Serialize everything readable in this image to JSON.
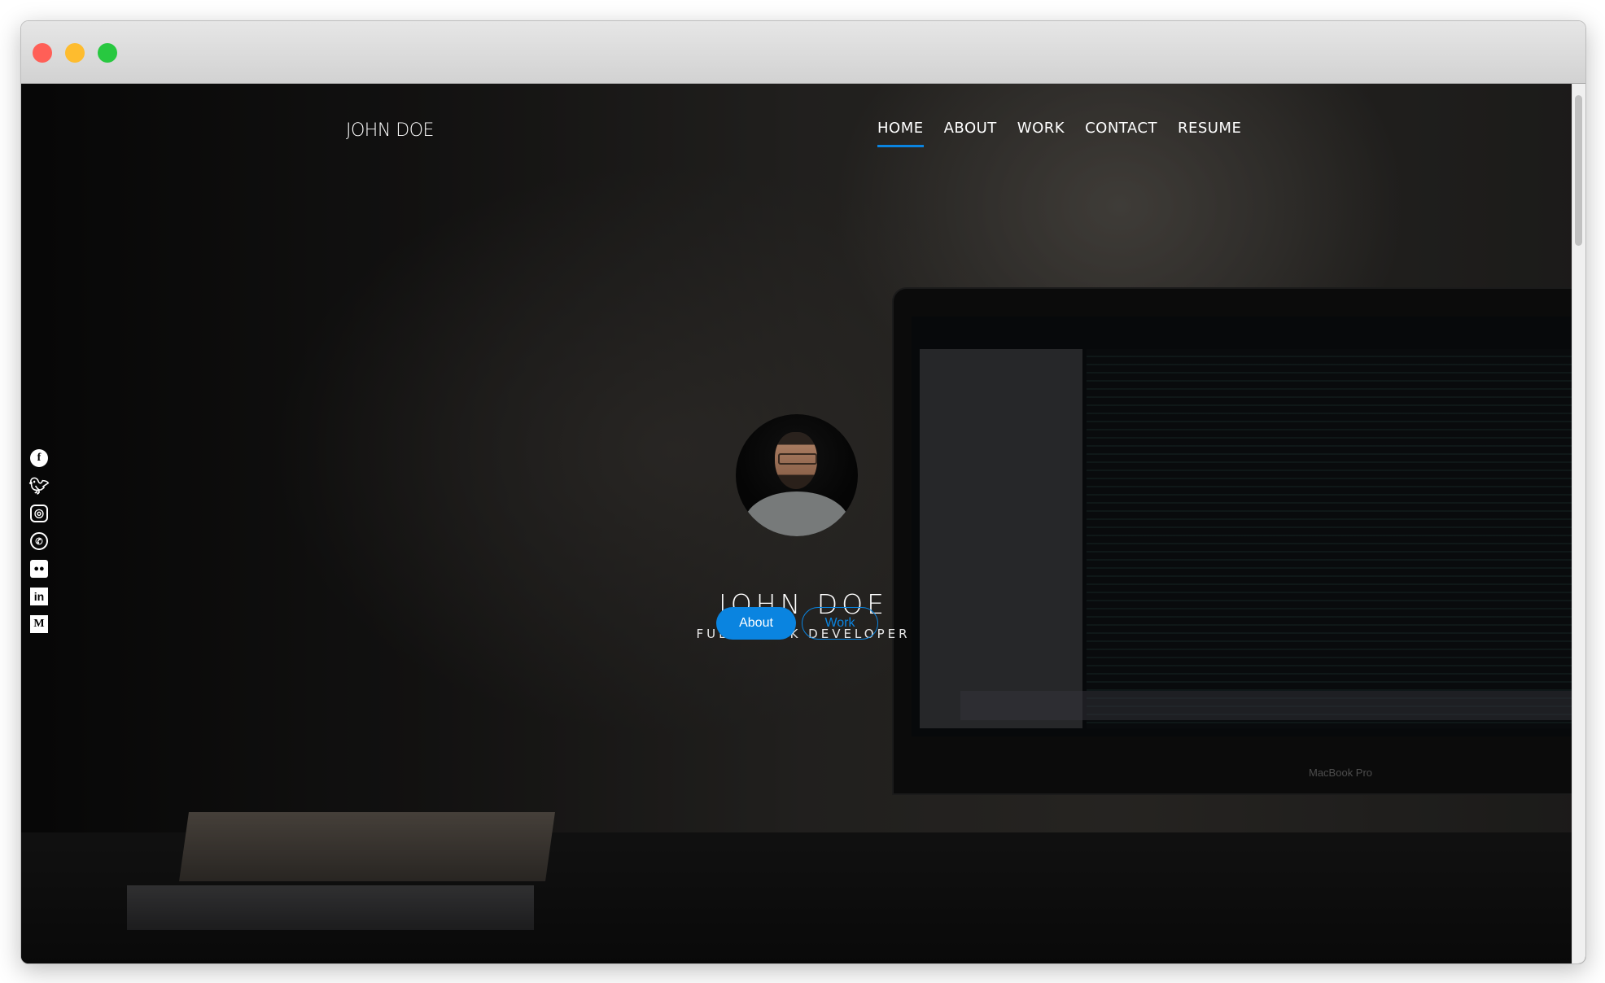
{
  "window": {
    "controls": [
      "close",
      "minimize",
      "zoom"
    ],
    "colors": {
      "close": "#ff5f57",
      "minimize": "#febc2e",
      "zoom": "#28c840"
    }
  },
  "nav": {
    "brand": "JOHN DOE",
    "items": [
      {
        "label": "HOME",
        "active": true
      },
      {
        "label": "ABOUT"
      },
      {
        "label": "WORK"
      },
      {
        "label": "CONTACT"
      },
      {
        "label": "RESUME"
      }
    ]
  },
  "hero": {
    "name": "JOHN DOE",
    "subtitle": "FULL STACK DEVELOPER",
    "buttons": {
      "about": "About",
      "work": "Work"
    }
  },
  "social": [
    "facebook-icon",
    "twitter-icon",
    "instagram-icon",
    "whatsapp-icon",
    "discord-icon",
    "linkedin-icon",
    "medium-icon"
  ],
  "background": {
    "laptop_label": "MacBook Pro"
  },
  "colors": {
    "accent": "#0a84e0"
  }
}
